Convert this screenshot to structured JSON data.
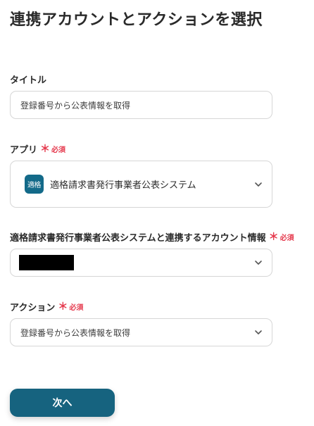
{
  "page": {
    "title": "連携アカウントとアクションを選択"
  },
  "fields": {
    "title": {
      "label": "タイトル",
      "value": "登録番号から公表情報を取得"
    },
    "app": {
      "label": "アプリ",
      "required_mark": "＊",
      "required_text": "必須",
      "icon_text": "適格",
      "value": "適格請求書発行事業者公表システム"
    },
    "account": {
      "label": "適格請求書発行事業者公表システムと連携するアカウント情報",
      "required_mark": "＊",
      "required_text": "必須"
    },
    "action": {
      "label": "アクション",
      "required_mark": "＊",
      "required_text": "必須",
      "value": "登録番号から公表情報を取得"
    }
  },
  "buttons": {
    "next_label": "次へ"
  },
  "colors": {
    "accent": "#16637f",
    "app_icon_bg": "#136a89",
    "required": "#e5394d",
    "border": "#d6d6d6"
  },
  "icons": {
    "dropdown": "chevron-down-icon"
  }
}
